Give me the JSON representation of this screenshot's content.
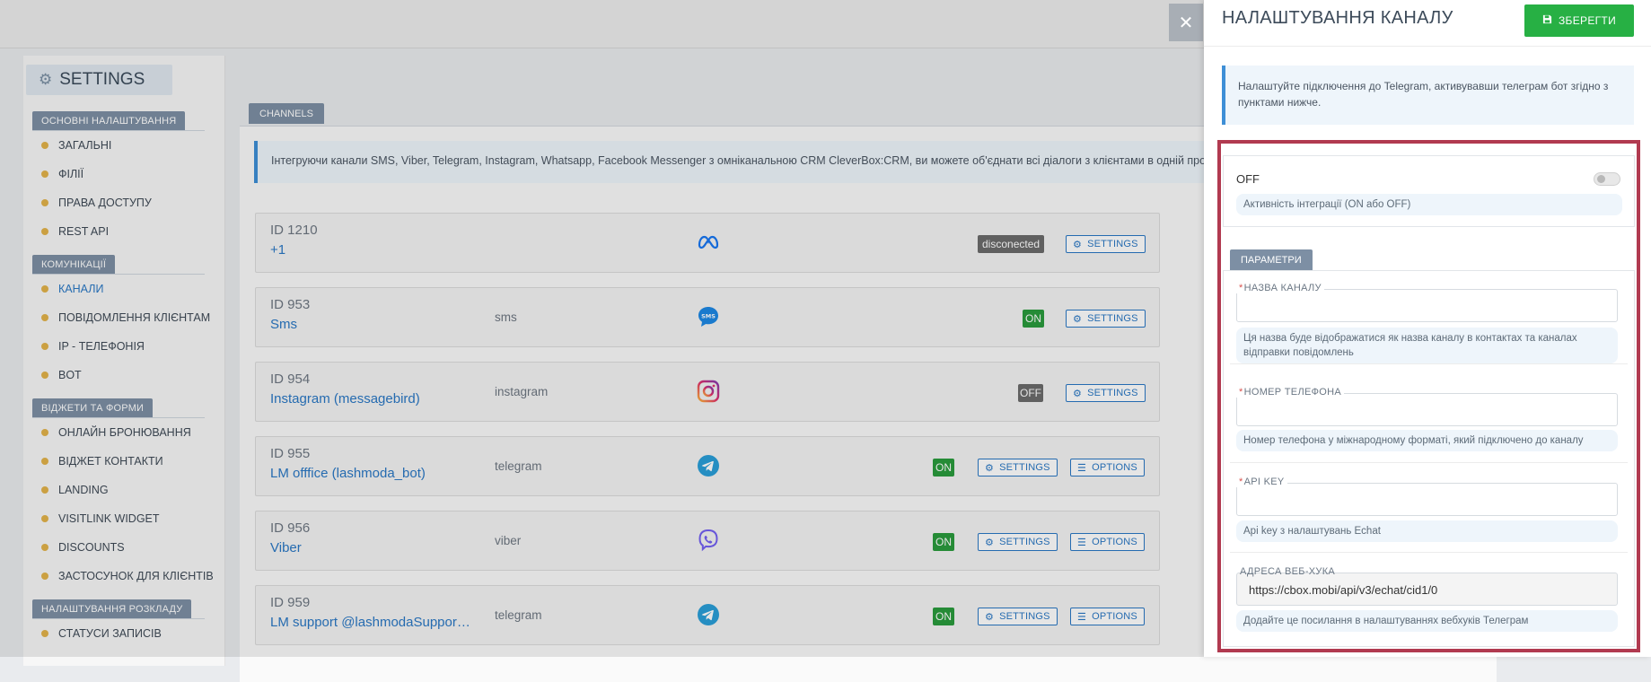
{
  "sidebar": {
    "title": "SETTINGS",
    "sections": [
      {
        "title": "ОСНОВНІ НАЛАШТУВАННЯ",
        "items": [
          "ЗАГАЛЬНІ",
          "ФІЛІЇ",
          "ПРАВА ДОСТУПУ",
          "REST API"
        ]
      },
      {
        "title": "КОМУНІКАЦІЇ",
        "items": [
          "КАНАЛИ",
          "ПОВІДОМЛЕННЯ КЛІЄНТАМ",
          "IP - ТЕЛЕФОНІЯ",
          "BOT"
        ]
      },
      {
        "title": "ВІДЖЕТИ ТА ФОРМИ",
        "items": [
          "ОНЛАЙН БРОНЮВАННЯ",
          "ВІДЖЕТ КОНТАКТИ",
          "LANDING",
          "VISITLINK WIDGET",
          "DISCOUNTS",
          "ЗАСТОСУНОК ДЛЯ КЛІЄНТІВ"
        ]
      },
      {
        "title": "НАЛАШТУВАННЯ РОЗКЛАДУ",
        "items": [
          "СТАТУСИ ЗАПИСІВ"
        ]
      }
    ]
  },
  "channels_tab": "CHANNELS",
  "channels_info": "Інтегруючи канали SMS, Viber, Telegram, Instagram, Whatsapp, Facebook Messenger з омніканальною CRM CleverBox:CRM, ви можете об'єднати всі діалоги з клієнтами в одній програмі",
  "channels": [
    {
      "id": "ID 1210",
      "name": "+1",
      "type": "",
      "icon": "meta-icon",
      "status": "disconected",
      "status_kind": "disc",
      "settings": "SETTINGS",
      "options": ""
    },
    {
      "id": "ID 953",
      "name": "Sms",
      "type": "sms",
      "icon": "sms-icon",
      "status": "ON",
      "status_kind": "on",
      "settings": "SETTINGS",
      "options": ""
    },
    {
      "id": "ID 954",
      "name": "Instagram (messagebird)",
      "type": "instagram",
      "icon": "instagram-icon",
      "status": "OFF",
      "status_kind": "off",
      "settings": "SETTINGS",
      "options": ""
    },
    {
      "id": "ID 955",
      "name": "LM offfice (lashmoda_bot)",
      "type": "telegram",
      "icon": "telegram-icon",
      "status": "ON",
      "status_kind": "on",
      "settings": "SETTINGS",
      "options": "OPTIONS"
    },
    {
      "id": "ID 956",
      "name": "Viber",
      "type": "viber",
      "icon": "viber-icon",
      "status": "ON",
      "status_kind": "on",
      "settings": "SETTINGS",
      "options": "OPTIONS"
    },
    {
      "id": "ID 959",
      "name": "LM support @lashmodaSupport_bot",
      "type": "telegram",
      "icon": "telegram-icon",
      "status": "ON",
      "status_kind": "on",
      "settings": "SETTINGS",
      "options": "OPTIONS"
    }
  ],
  "drawer": {
    "title": "НАЛАШТУВАННЯ КАНАЛУ",
    "save_label": "ЗБЕРЕГТИ",
    "info": "Налаштуйте підключення до Telegram, активувавши телеграм бот згідно з пунктами нижче.",
    "toggle_label": "OFF",
    "toggle_hint": "Активність інтеграції (ON або OFF)",
    "params_tab": "ПАРАМЕТРИ",
    "fields": [
      {
        "label": "НАЗВА КАНАЛУ",
        "required": "*",
        "value": "",
        "hint": "Ця назва буде відображатися як назва каналу в контактах та каналах відправки повідомлень"
      },
      {
        "label": "НОМЕР ТЕЛЕФОНА",
        "required": "*",
        "value": "",
        "hint": "Номер телефона у міжнародному форматі, який підключено до каналу"
      },
      {
        "label": "API KEY",
        "required": "*",
        "value": "",
        "hint": "Api key з налаштувань Echat"
      },
      {
        "label": "АДРЕСА ВЕБ-ХУКА",
        "required": "",
        "value": "https://cbox.mobi/api/v3/echat/cid1/0",
        "hint": "Додайте це посилання в налаштуваннях вебхуків Телеграм"
      }
    ]
  },
  "colors": {
    "accent": "#2a78c5",
    "success": "#27b044",
    "highlight": "#b13a50"
  }
}
